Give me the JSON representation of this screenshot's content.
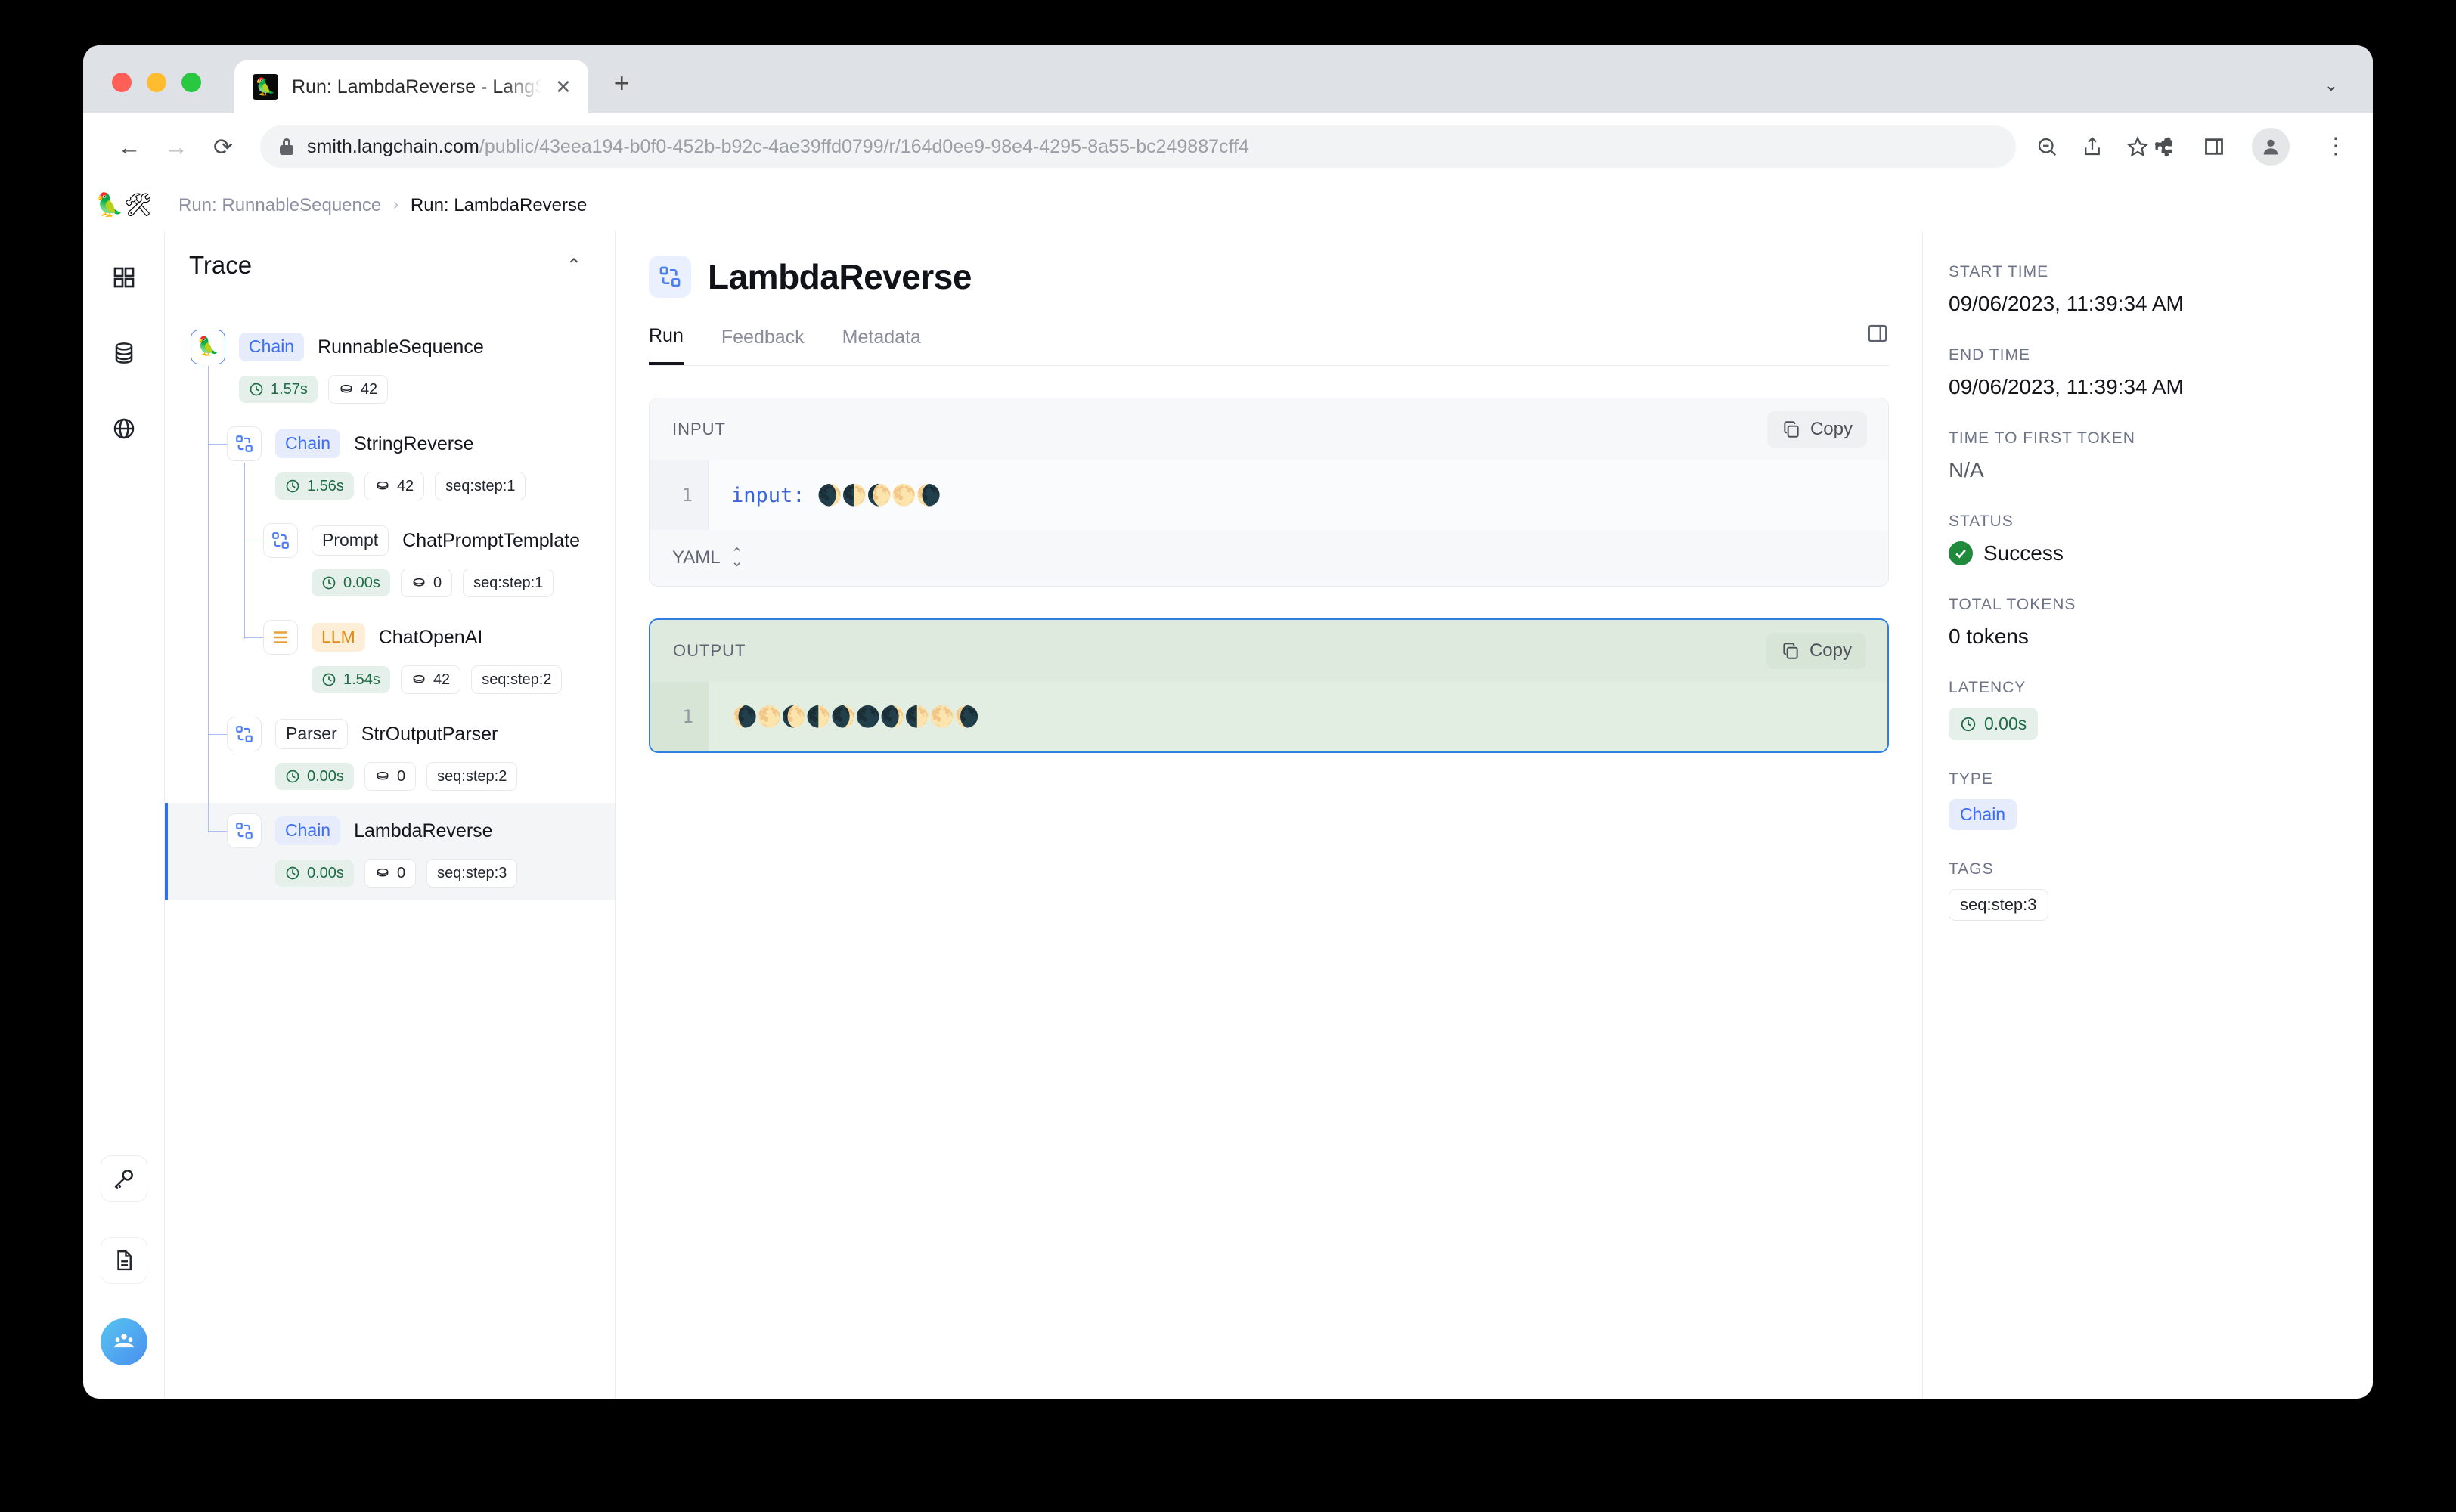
{
  "browser": {
    "tab": {
      "title": "Run: LambdaReverse - LangSm",
      "favicon": "parrot-icon",
      "close": "✕"
    },
    "new_tab": "+",
    "tabstrip_caret": "⌄",
    "nav": {
      "back": "←",
      "forward": "→",
      "reload": "⟳"
    },
    "url": {
      "host": "smith.langchain.com",
      "path": "/public/43eea194-b0f0-452b-b92c-4ae39ffd0799/r/164d0ee9-98e4-4295-8a55-bc249887cff4"
    },
    "toolbar_icons": [
      "zoom-out-icon",
      "share-icon",
      "bookmark-star-icon",
      "extensions-icon",
      "side-panel-icon",
      "profile-icon"
    ],
    "menu": "⋮"
  },
  "app": {
    "logo": "🦜🛠",
    "breadcrumb": {
      "parent": "Run: RunnableSequence",
      "separator": "›",
      "current": "Run: LambdaReverse"
    },
    "rail": {
      "top_items": [
        "grid-icon",
        "database-icon",
        "globe-icon"
      ],
      "bottom_items": [
        "key-icon",
        "document-icon",
        "organization-avatar"
      ]
    },
    "trace": {
      "title": "Trace",
      "collapse": "⌃",
      "nodes": [
        {
          "icon": "parrot-icon",
          "type": "Chain",
          "type_style": "chain",
          "name": "RunnableSequence",
          "time": "1.57s",
          "tokens": "42",
          "tag": "",
          "depth": 0,
          "selected": false
        },
        {
          "icon": "chain-icon",
          "type": "Chain",
          "type_style": "chain",
          "name": "StringReverse",
          "time": "1.56s",
          "tokens": "42",
          "tag": "seq:step:1",
          "depth": 1,
          "selected": false
        },
        {
          "icon": "chain-icon",
          "type": "Prompt",
          "type_style": "prompt",
          "name": "ChatPromptTemplate",
          "time": "0.00s",
          "tokens": "0",
          "tag": "seq:step:1",
          "depth": 2,
          "selected": false
        },
        {
          "icon": "llm-icon",
          "type": "LLM",
          "type_style": "llm",
          "name": "ChatOpenAI",
          "time": "1.54s",
          "tokens": "42",
          "tag": "seq:step:2",
          "depth": 2,
          "selected": false
        },
        {
          "icon": "chain-icon",
          "type": "Parser",
          "type_style": "parser",
          "name": "StrOutputParser",
          "time": "0.00s",
          "tokens": "0",
          "tag": "seq:step:2",
          "depth": 1,
          "selected": false
        },
        {
          "icon": "chain-icon",
          "type": "Chain",
          "type_style": "chain",
          "name": "LambdaReverse",
          "time": "0.00s",
          "tokens": "0",
          "tag": "seq:step:3",
          "depth": 1,
          "selected": true
        }
      ]
    },
    "run": {
      "icon": "chain-icon",
      "title": "LambdaReverse",
      "tabs": [
        {
          "label": "Run",
          "active": true
        },
        {
          "label": "Feedback",
          "active": false
        },
        {
          "label": "Metadata",
          "active": false
        }
      ],
      "panel_toggle": "side-panel-icon"
    },
    "input_card": {
      "label": "INPUT",
      "copy_label": "Copy",
      "line_number": "1",
      "code_key": "input:",
      "code_value": "🌒🌓🌔🌕🌘",
      "format": "YAML"
    },
    "output_card": {
      "label": "OUTPUT",
      "copy_label": "Copy",
      "line_number": "1",
      "code_value": "🌘🌕🌔🌓🌒🌑🌒🌓🌕🌘"
    },
    "meta": {
      "start_time_label": "START TIME",
      "start_time": "09/06/2023, 11:39:34 AM",
      "end_time_label": "END TIME",
      "end_time": "09/06/2023, 11:39:34 AM",
      "ttft_label": "TIME TO FIRST TOKEN",
      "ttft": "N/A",
      "status_label": "STATUS",
      "status": "Success",
      "tokens_label": "TOTAL TOKENS",
      "tokens": "0 tokens",
      "latency_label": "LATENCY",
      "latency": "0.00s",
      "type_label": "TYPE",
      "type": "Chain",
      "tags_label": "TAGS",
      "tag": "seq:step:3"
    }
  },
  "colors": {
    "accent_blue": "#3b6df3",
    "success_green": "#1f8a3b",
    "output_border": "#2f7fe0",
    "llm_orange": "#e08b17"
  }
}
